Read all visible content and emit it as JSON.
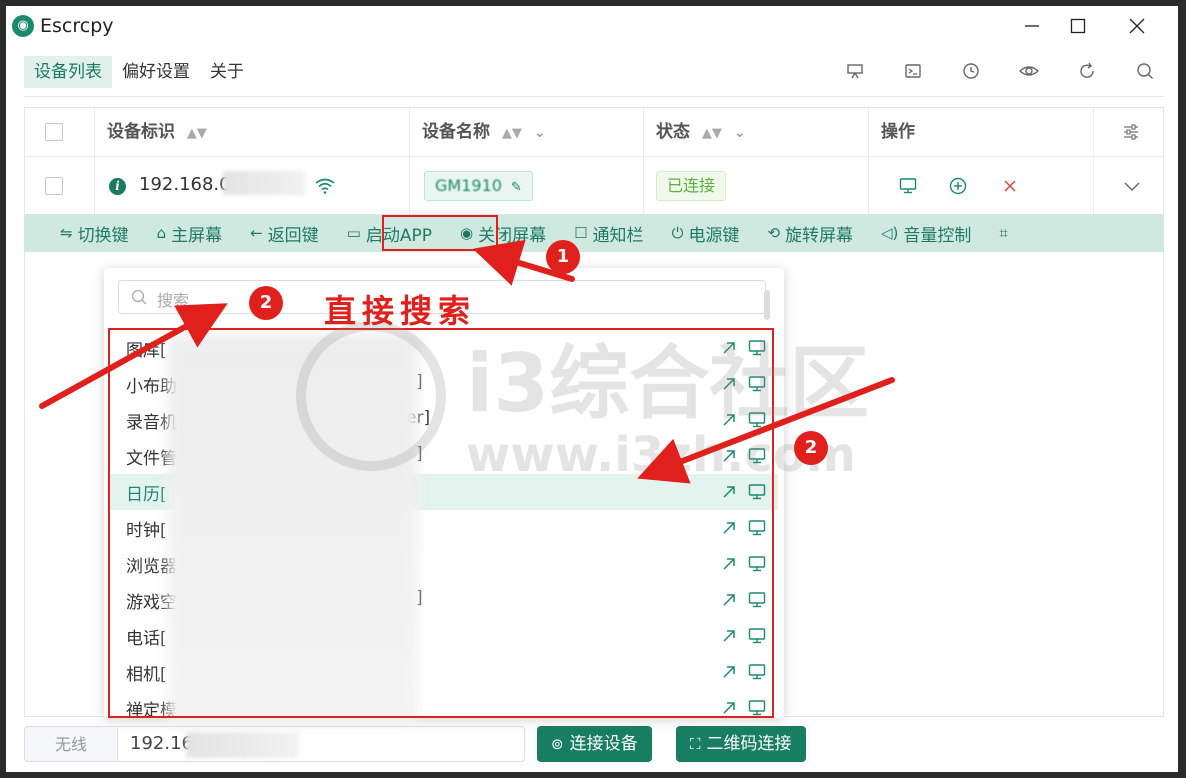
{
  "window": {
    "title": "Escrcpy",
    "minimize": "—",
    "maximize": "□",
    "close": "✕"
  },
  "menu": [
    {
      "label": "设备列表",
      "active": true
    },
    {
      "label": "偏好设置",
      "active": false
    },
    {
      "label": "关于",
      "active": false
    }
  ],
  "toolbar_icons": [
    "presentation-icon",
    "terminal-icon",
    "clock-icon",
    "eye-icon",
    "refresh-icon",
    "search-icon"
  ],
  "table": {
    "headers": {
      "device_id": "设备标识",
      "device_name": "设备名称",
      "status": "状态",
      "actions": "操作"
    },
    "row": {
      "ip": "192.168.0",
      "name": "GM1910",
      "status": "已连接"
    }
  },
  "actionbar": [
    {
      "label": "切换键",
      "icon": "⇋"
    },
    {
      "label": "主屏幕",
      "icon": "⌂"
    },
    {
      "label": "返回键",
      "icon": "←"
    },
    {
      "label": "启动APP",
      "icon": "▭"
    },
    {
      "label": "关闭屏幕",
      "icon": "◉"
    },
    {
      "label": "通知栏",
      "icon": "☐"
    },
    {
      "label": "电源键",
      "icon": "⏻"
    },
    {
      "label": "旋转屏幕",
      "icon": "⟲"
    },
    {
      "label": "音量控制",
      "icon": "◁)"
    }
  ],
  "search": {
    "placeholder": "搜索"
  },
  "apps": [
    {
      "name": "图库[",
      "tail": "",
      "selected": false
    },
    {
      "name": "小布助",
      "tail": "]",
      "selected": false
    },
    {
      "name": "录音机",
      "tail": "er]",
      "selected": false
    },
    {
      "name": "文件管",
      "tail": "]",
      "selected": false
    },
    {
      "name": "日历[",
      "tail": "",
      "selected": true
    },
    {
      "name": "时钟[",
      "tail": "",
      "selected": false
    },
    {
      "name": "浏览器",
      "tail": "",
      "selected": false
    },
    {
      "name": "游戏空",
      "tail": "]",
      "selected": false
    },
    {
      "name": "电话[",
      "tail": "",
      "selected": false
    },
    {
      "name": "相机[",
      "tail": "",
      "selected": false
    },
    {
      "name": "禅定模",
      "tail": "",
      "selected": false
    }
  ],
  "bottom": {
    "wireless_label": "无线",
    "ip_value": "192.16",
    "connect_button": "连接设备",
    "qr_button": "二维码连接"
  },
  "annotations": {
    "badge1": "1",
    "badge2a": "2",
    "badge2b": "2",
    "handwritten": "直接搜索"
  },
  "watermark": {
    "text": "i3综合社区",
    "url": "www.i3zh.com"
  },
  "colors": {
    "accent": "#187e62",
    "annotation": "#e0201c",
    "actionbar_bg": "#cfe9e1"
  }
}
